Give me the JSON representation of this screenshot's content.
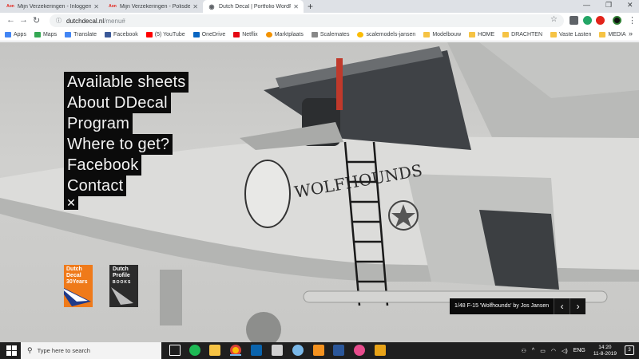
{
  "browser": {
    "tabs": [
      {
        "title": "Mijn Verzekeringen - Inloggen",
        "favicon": "Aon",
        "active": false
      },
      {
        "title": "Mijn Verzekeringen - Polisdetails",
        "favicon": "Aon",
        "active": false
      },
      {
        "title": "Dutch Decal | Portfolio WordPres",
        "favicon": "globe-icon",
        "active": true
      }
    ],
    "new_tab": "+",
    "url_host": "dutchdecal.nl",
    "url_path": "/menu#",
    "bookmarks": [
      "Apps",
      "Maps",
      "Translate",
      "Facebook",
      "(5) YouTube",
      "OneDrive",
      "Netflix",
      "Marktplaats",
      "Scalemates",
      "scalemodels-jansen",
      "Modelbouw",
      "HOME",
      "DRACHTEN",
      "Vaste Lasten",
      "MEDIA"
    ],
    "bookmarks_more": "»"
  },
  "page": {
    "menu": [
      "Available sheets",
      "About DDecal",
      "Program",
      "Where to get?",
      "Facebook",
      "Contact"
    ],
    "close_icon": "✕",
    "logo_dutch_decal": {
      "line1": "Dutch",
      "line2": "Decal",
      "line3": "30Years"
    },
    "logo_dutch_profile": {
      "line1": "Dutch",
      "line2": "Profile",
      "line3": "BOOKS"
    },
    "caption": "1/48 F-15 'Wolfhounds' by Jos Jansen",
    "prev": "‹",
    "next": "›",
    "colors": {
      "accent_orange": "#ef7a1a",
      "menu_bg": "#0b0b0b"
    }
  },
  "taskbar": {
    "search_placeholder": "Type here to search",
    "language": "ENG",
    "time": "14:20",
    "date": "11-8-2019",
    "notifications": "3"
  }
}
